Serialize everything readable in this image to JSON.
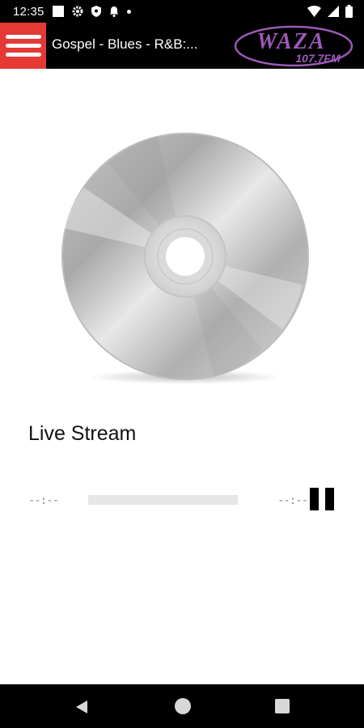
{
  "status_bar": {
    "time": "12:35",
    "left_icons": [
      "square-icon",
      "gear-icon",
      "shield-icon",
      "bell-icon",
      "dot-icon"
    ],
    "right_icons": [
      "wifi-icon",
      "signal-icon",
      "battery-icon"
    ]
  },
  "app_bar": {
    "title": "Gospel - Blues - R&B:...",
    "logo_text": "WAZA",
    "logo_subtext": "107.7FM",
    "colors": {
      "menu_bg": "#e53935",
      "logo": "#9b59b6"
    }
  },
  "player": {
    "track_title": "Live Stream",
    "elapsed": "--:--",
    "duration": "--:--",
    "progress": 0,
    "state": "playing"
  },
  "nav_bar": {
    "buttons": [
      "back-icon",
      "home-icon",
      "recents-icon"
    ]
  }
}
